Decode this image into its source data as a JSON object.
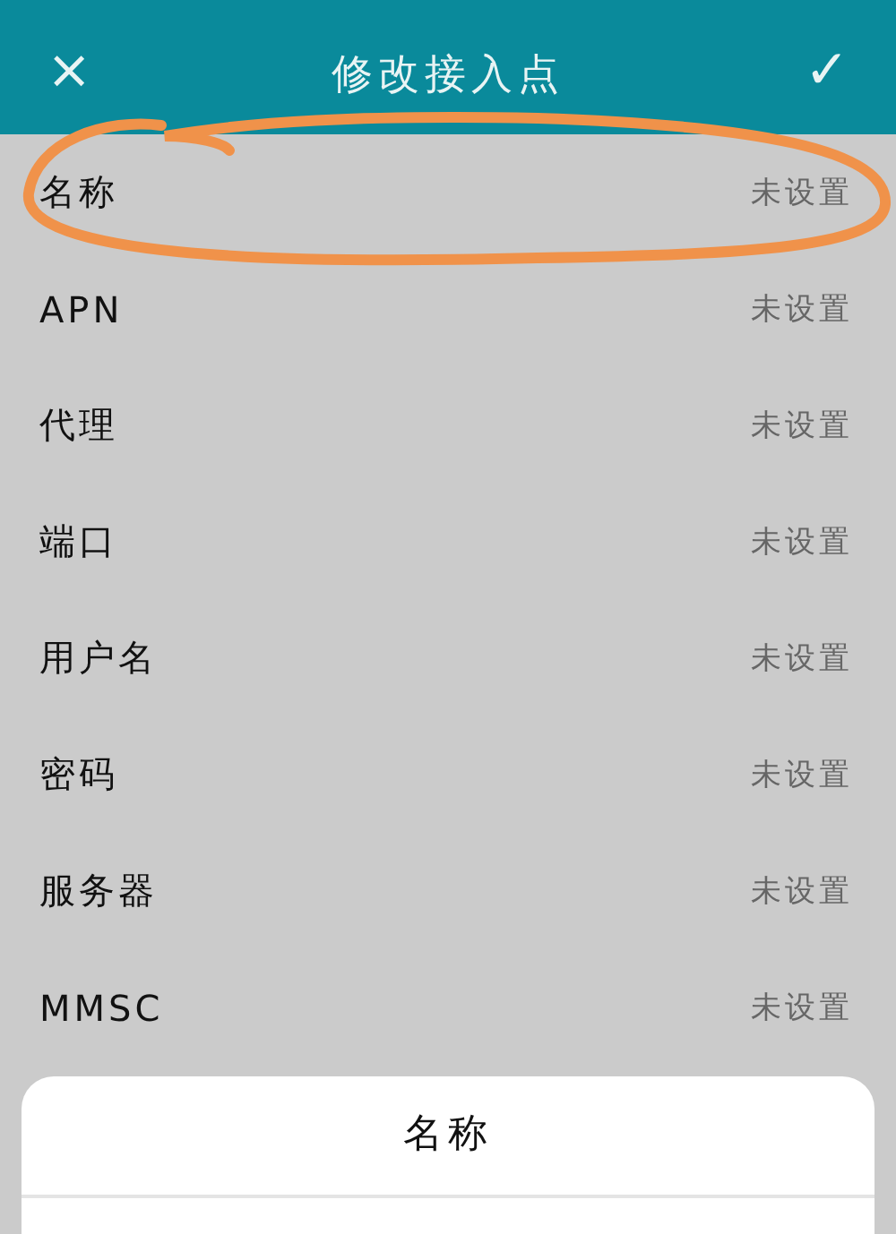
{
  "header": {
    "title": "修改接入点",
    "close": "×",
    "confirm": "✓"
  },
  "rows": [
    {
      "label": "名称",
      "value": "未设置"
    },
    {
      "label": "APN",
      "value": "未设置"
    },
    {
      "label": "代理",
      "value": "未设置"
    },
    {
      "label": "端口",
      "value": "未设置"
    },
    {
      "label": "用户名",
      "value": "未设置"
    },
    {
      "label": "密码",
      "value": "未设置"
    },
    {
      "label": "服务器",
      "value": "未设置"
    },
    {
      "label": "MMSC",
      "value": "未设置"
    }
  ],
  "dialog": {
    "title": "名称"
  }
}
